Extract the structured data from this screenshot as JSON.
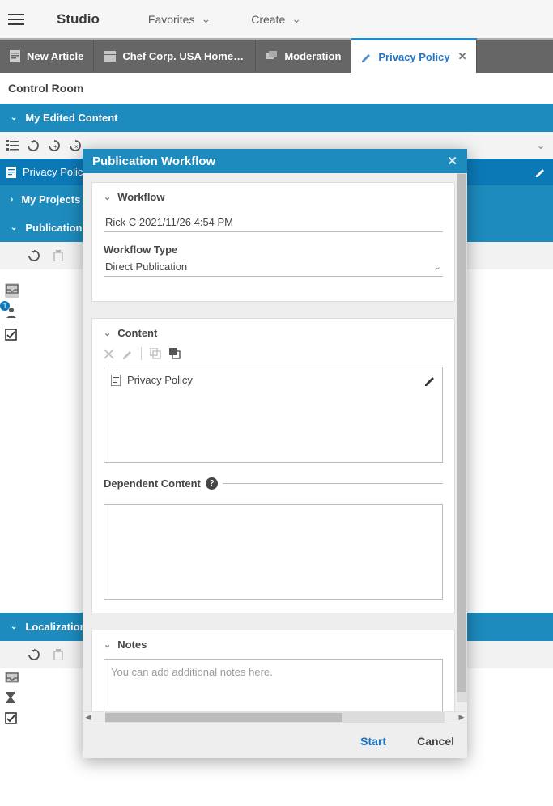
{
  "header": {
    "brand": "Studio",
    "menus": [
      {
        "label": "Favorites"
      },
      {
        "label": "Create"
      }
    ]
  },
  "tabs": [
    {
      "label": "New Article"
    },
    {
      "label": "Chef Corp. USA Home Pa…"
    },
    {
      "label": "Moderation"
    },
    {
      "label": "Privacy Policy"
    }
  ],
  "control_room": "Control Room",
  "panels": {
    "my_edited": {
      "title": "My Edited Content"
    },
    "my_projects": {
      "title": "My Projects"
    },
    "pub_workflow": {
      "title": "Publication W"
    },
    "localization": {
      "title": "Localization"
    }
  },
  "edited_item": {
    "label": "Privacy Polic"
  },
  "badge_count": "1",
  "modal": {
    "title": "Publication Workflow",
    "workflow_section": "Workflow",
    "workflow_value": "Rick C 2021/11/26 4:54 PM",
    "workflow_type_label": "Workflow Type",
    "workflow_type_value": "Direct Publication",
    "content_section": "Content",
    "content_item": "Privacy Policy",
    "dependent_label": "Dependent Content",
    "notes_section": "Notes",
    "notes_placeholder": "You can add additional notes here.",
    "start": "Start",
    "cancel": "Cancel"
  }
}
